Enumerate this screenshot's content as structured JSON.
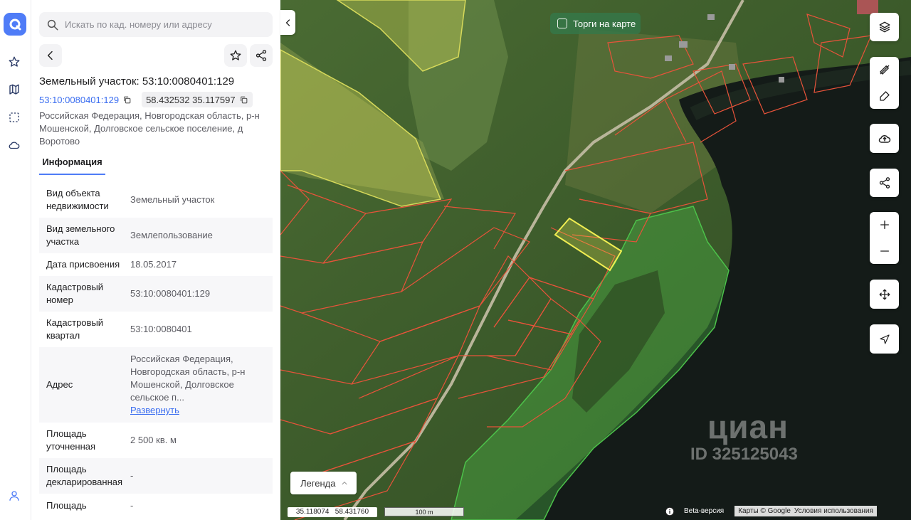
{
  "search": {
    "placeholder": "Искать по кад. номеру или адресу"
  },
  "object": {
    "title": "Земельный участок: 53:10:0080401:129",
    "cad_number": "53:10:0080401:129",
    "coordinates": "58.432532 35.117597",
    "address": "Российская Федерация, Новгородская область, р-н Мошенской, Долговское сельское поселение, д Воротово"
  },
  "tabs": {
    "info": "Информация"
  },
  "info_rows": [
    {
      "key": "Вид объекта недвижимости",
      "value": "Земельный участок"
    },
    {
      "key": "Вид земельного участка",
      "value": "Землепользование"
    },
    {
      "key": "Дата присвоения",
      "value": "18.05.2017"
    },
    {
      "key": "Кадастровый номер",
      "value": "53:10:0080401:129"
    },
    {
      "key": "Кадастровый квартал",
      "value": "53:10:0080401"
    },
    {
      "key": "Адрес",
      "value": "Российская Федерация, Новгородская область, р-н Мошенской, Долговское сельское п...",
      "link": "Развернуть"
    },
    {
      "key": "Площадь уточненная",
      "value": "2 500 кв. м"
    },
    {
      "key": "Площадь декларированная",
      "value": "-"
    },
    {
      "key": "Площадь",
      "value": "-"
    }
  ],
  "map": {
    "torgi_label": "Торги на карте",
    "legend_label": "Легенда",
    "cursor_coords": "35.118074   58.431760",
    "scale_label": "100 m",
    "beta_label": "Beta-версия",
    "attribution": "Карты © Google",
    "terms": "Условия использования",
    "watermark_brand": "циан",
    "watermark_id": "ID 325125043"
  },
  "colors": {
    "accent": "#4f7cf7",
    "parcel_outline": "#e8533a",
    "selected_parcel": "#f1ee52",
    "forest_zone": "#4cc24a",
    "meadow_zone": "#d6d95a"
  },
  "icons": [
    "search-icon",
    "back-icon",
    "star-icon",
    "share-icon",
    "copy-icon",
    "layers-icon",
    "ruler-icon",
    "edit-icon",
    "upload-icon",
    "zoom-in-icon",
    "zoom-out-icon",
    "move-icon",
    "locate-icon",
    "user-icon"
  ]
}
